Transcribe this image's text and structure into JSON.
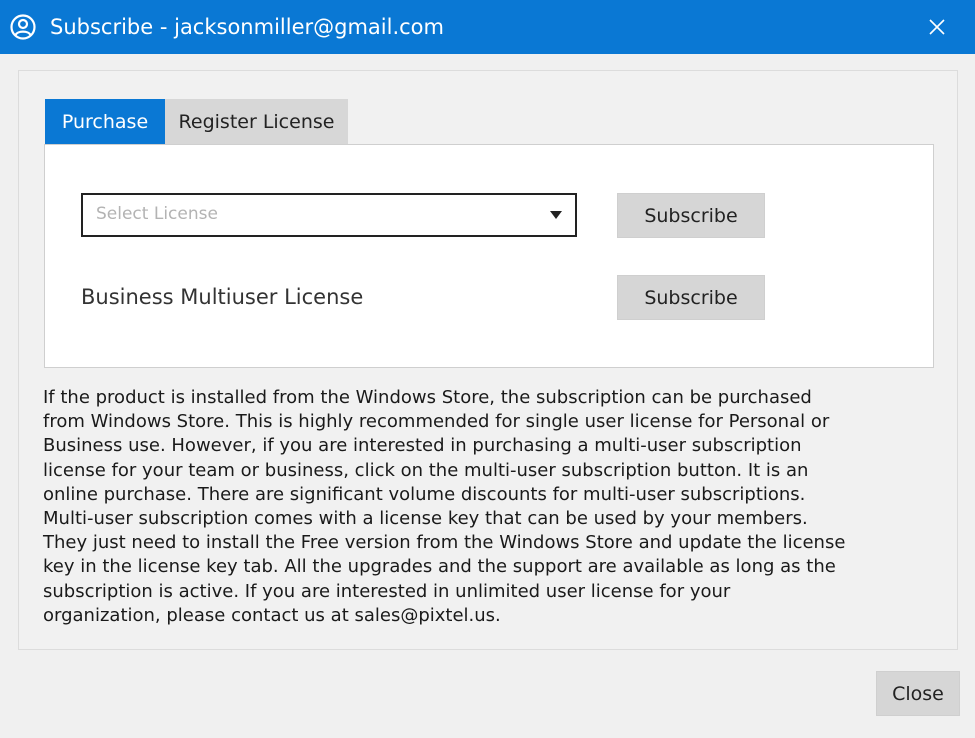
{
  "window": {
    "title": "Subscribe - jacksonmiller@gmail.com",
    "accent_color": "#0a78d4",
    "title_icon": "user-circle-icon",
    "close_icon": "close-icon"
  },
  "tabs": [
    {
      "label": "Purchase",
      "active": true
    },
    {
      "label": "Register License",
      "active": false
    }
  ],
  "purchase": {
    "license_select": {
      "placeholder": "Select License",
      "value": ""
    },
    "subscribe_label_1": "Subscribe",
    "business_label": "Business Multiuser License",
    "subscribe_label_2": "Subscribe"
  },
  "description": "If the product is installed from the Windows Store, the subscription can be purchased\nfrom Windows Store. This is highly recommended for single user license for Personal or\nBusiness use. However, if you are interested in purchasing a multi-user subscription\nlicense for your team or business, click on the multi-user subscription button. It is an\nonline purchase. There are significant volume discounts for multi-user subscriptions.\nMulti-user subscription comes with a license key that can be used by your members.\nThey just need to install the Free version from the Windows Store and update the license\nkey in the license key tab. All the upgrades and the support are available as long as the\nsubscription is active. If you are interested in unlimited user license for your\norganization, please contact us at sales@pixtel.us.",
  "footer": {
    "close_label": "Close"
  }
}
